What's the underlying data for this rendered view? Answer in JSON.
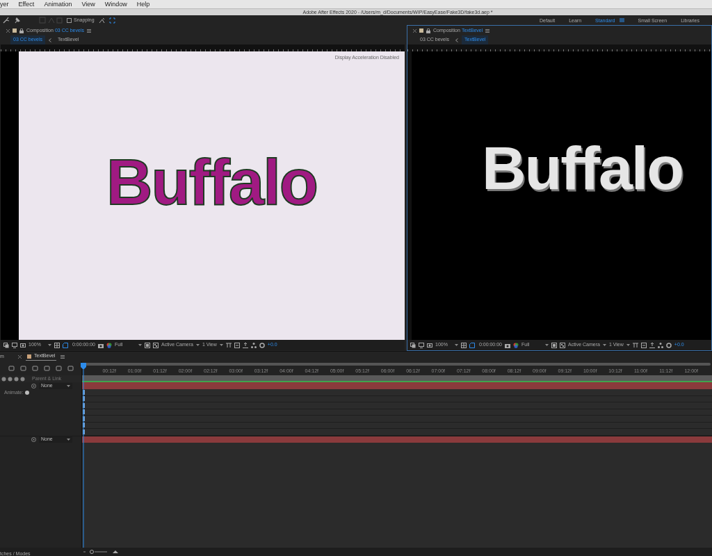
{
  "menu_bar": {
    "items": [
      "yer",
      "Effect",
      "Animation",
      "View",
      "Window",
      "Help"
    ]
  },
  "title_bar": {
    "title": "Adobe After Effects 2020 - /Users/m_d/Documents/WIP/EasyEase/Fake3D/fake3d.aep *"
  },
  "toolbar": {
    "snapping": {
      "label": "Snapping",
      "checked": false
    },
    "workspaces": [
      {
        "label": "Default",
        "selected": false
      },
      {
        "label": "Learn",
        "selected": false
      },
      {
        "label": "Standard",
        "selected": true
      },
      {
        "label": "Small Screen",
        "selected": false
      },
      {
        "label": "Libraries",
        "selected": false
      }
    ]
  },
  "viewers": [
    {
      "header_prefix": "Composition",
      "comp_name": "03 CC bevels",
      "active": false,
      "breadcrumbs": [
        {
          "label": "03 CC bevels",
          "selected": true
        },
        {
          "label": "TextBevel",
          "selected": false
        }
      ],
      "canvas": {
        "kind": "light",
        "notice": "Display Acceleration Disabled",
        "text": "Buffalo"
      },
      "controls": {
        "zoom": "100%",
        "timecode": "0:00:00:00",
        "resolution": "Full",
        "camera": "Active Camera",
        "views": "1 View",
        "exposure": "+0.0"
      }
    },
    {
      "header_prefix": "Composition",
      "comp_name": "TextBevel",
      "active": true,
      "breadcrumbs": [
        {
          "label": "03 CC bevels",
          "selected": false
        },
        {
          "label": "TextBevel",
          "selected": true
        }
      ],
      "canvas": {
        "kind": "dark",
        "text": "Buffalo"
      },
      "controls": {
        "zoom": "100%",
        "timecode": "0:00:00:00",
        "resolution": "Full",
        "camera": "Active Camera",
        "views": "1 View",
        "exposure": "+0.0"
      }
    }
  ],
  "timeline": {
    "left_cut_label": "m",
    "tab": {
      "label": "TextBevel"
    },
    "column_header": "Parent & Link",
    "ruler_labels": [
      "00:12f",
      "01:00f",
      "01:12f",
      "02:00f",
      "02:12f",
      "03:00f",
      "03:12f",
      "04:00f",
      "04:12f",
      "05:00f",
      "05:12f",
      "06:00f",
      "06:12f",
      "07:00f",
      "07:12f",
      "08:00f",
      "08:12f",
      "09:00f",
      "09:12f",
      "10:00f",
      "10:12f",
      "11:00f",
      "11:12f",
      "12:00f"
    ],
    "layers": [
      {
        "parent": "None",
        "expanded": true,
        "properties_label": "Animate:"
      },
      {
        "parent": "None",
        "expanded": false
      }
    ],
    "status": "tches / Modes"
  }
}
